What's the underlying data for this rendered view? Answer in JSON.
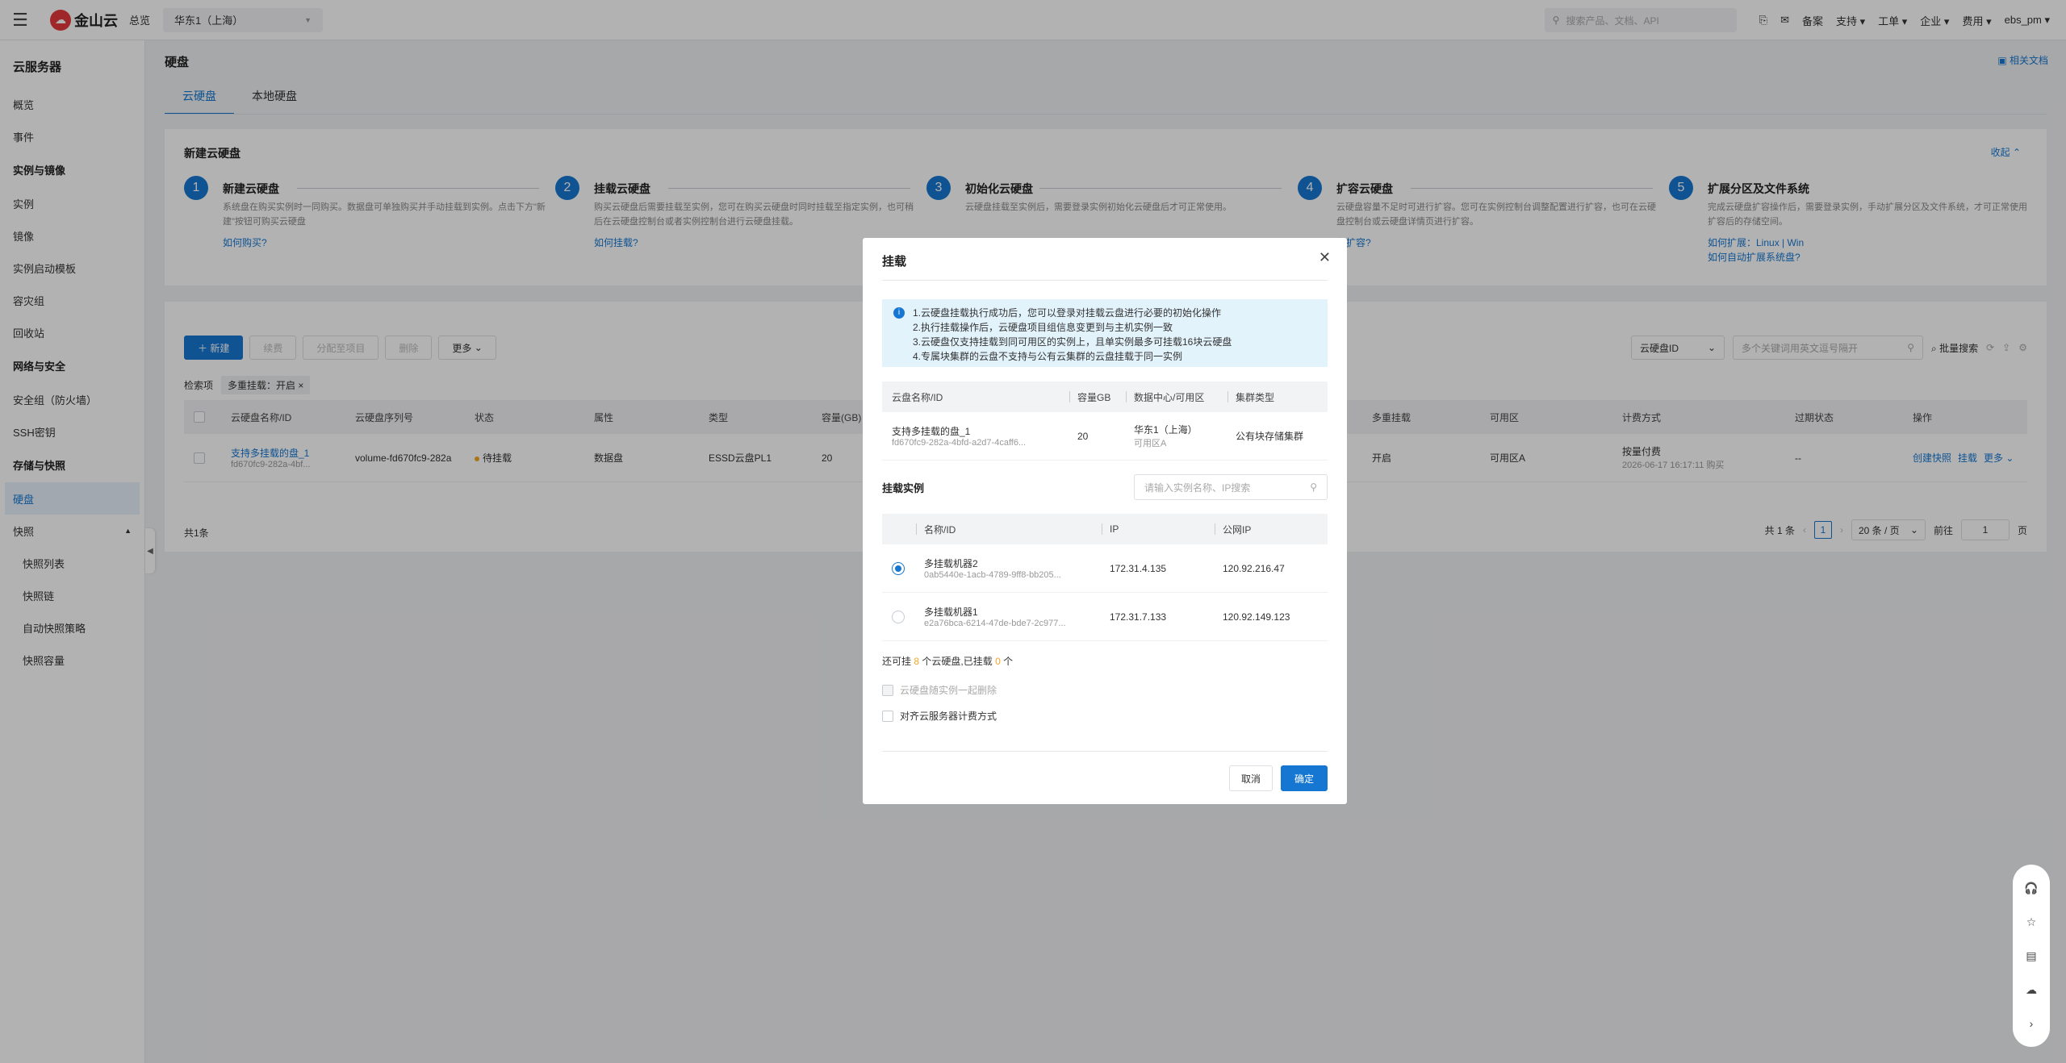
{
  "topbar": {
    "overview": "总览",
    "region": "华东1（上海）",
    "search_placeholder": "搜索产品、文档、API",
    "items": [
      "备案",
      "支持",
      "工单",
      "企业",
      "费用",
      "ebs_pm"
    ],
    "logo": "金山云"
  },
  "sidebar": {
    "title": "云服务器",
    "items": [
      {
        "type": "item",
        "label": "概览"
      },
      {
        "type": "item",
        "label": "事件"
      },
      {
        "type": "group",
        "label": "实例与镜像"
      },
      {
        "type": "item",
        "label": "实例"
      },
      {
        "type": "item",
        "label": "镜像"
      },
      {
        "type": "item",
        "label": "实例启动模板"
      },
      {
        "type": "item",
        "label": "容灾组"
      },
      {
        "type": "item",
        "label": "回收站"
      },
      {
        "type": "group",
        "label": "网络与安全"
      },
      {
        "type": "item",
        "label": "安全组（防火墙）"
      },
      {
        "type": "item",
        "label": "SSH密钥"
      },
      {
        "type": "group",
        "label": "存储与快照"
      },
      {
        "type": "item",
        "label": "硬盘",
        "active": true
      },
      {
        "type": "item",
        "label": "快照",
        "expanded": true
      },
      {
        "type": "sub",
        "label": "快照列表"
      },
      {
        "type": "sub",
        "label": "快照链"
      },
      {
        "type": "sub",
        "label": "自动快照策略"
      },
      {
        "type": "sub",
        "label": "快照容量"
      }
    ]
  },
  "page": {
    "title": "硬盘",
    "doc_link": "相关文档",
    "tabs": [
      "云硬盘",
      "本地硬盘"
    ]
  },
  "guide": {
    "title": "新建云硬盘",
    "collapse": "收起",
    "steps": [
      {
        "num": "1",
        "name": "新建云硬盘",
        "desc": "系统盘在购买实例时一同购买。数据盘可单独购买并手动挂载到实例。点击下方\"新建\"按钮可购买云硬盘",
        "link": "如何购买?"
      },
      {
        "num": "2",
        "name": "挂载云硬盘",
        "desc": "购买云硬盘后需要挂载至实例，您可在购买云硬盘时同时挂载至指定实例，也可稍后在云硬盘控制台或者实例控制台进行云硬盘挂载。",
        "link": "如何挂载?"
      },
      {
        "num": "3",
        "name": "初始化云硬盘",
        "desc": "云硬盘挂载至实例后，需要登录实例初始化云硬盘后才可正常使用。",
        "link": ""
      },
      {
        "num": "4",
        "name": "扩容云硬盘",
        "desc": "云硬盘容量不足时可进行扩容。您可在实例控制台调整配置进行扩容，也可在云硬盘控制台或云硬盘详情页进行扩容。",
        "link": "何扩容?"
      },
      {
        "num": "5",
        "name": "扩展分区及文件系统",
        "desc": "完成云硬盘扩容操作后，需要登录实例，手动扩展分区及文件系统，才可正常使用扩容后的存储空间。",
        "link": "如何扩展：Linux | Win",
        "link2": "如何自动扩展系统盘?"
      }
    ]
  },
  "toolbar": {
    "new": "新建",
    "buttons": [
      "续费",
      "分配至项目",
      "删除"
    ],
    "more": "更多"
  },
  "filter": {
    "label": "检索项",
    "chip": "多重挂载：开启"
  },
  "search2": {
    "select": "云硬盘ID",
    "placeholder": "多个关键词用英文逗号隔开",
    "batch": "批量搜索"
  },
  "table": {
    "headers": [
      "云硬盘名称/ID",
      "云硬盘序列号",
      "状态",
      "属性",
      "类型",
      "容量(GB)",
      "多重挂载",
      "可用区",
      "计费方式",
      "过期状态",
      "操作"
    ],
    "row": {
      "name": "支持多挂载的盘_1",
      "id": "fd670fc9-282a-4bf...",
      "serial": "volume-fd670fc9-282a",
      "status": "待挂载",
      "attr": "数据盘",
      "type": "ESSD云盘PL1",
      "cap": "20",
      "multi": "开启",
      "zone": "可用区A",
      "billing": "按量付费",
      "billing_time": "2026-06-17 16:17:11 购买",
      "expire": "--",
      "actions": [
        "创建快照",
        "挂载",
        "更多"
      ]
    }
  },
  "table_footer": {
    "total": "共1条",
    "pager_total": "共 1 条",
    "page": "1",
    "size": "20 条 / 页",
    "goto": "前往",
    "goto_val": "1",
    "goto_suffix": "页"
  },
  "modal": {
    "title": "挂载",
    "notice": [
      "1.云硬盘挂载执行成功后，您可以登录对挂载云盘进行必要的初始化操作",
      "2.执行挂载操作后，云硬盘项目组信息变更到与主机实例一致",
      "3.云硬盘仅支持挂载到同可用区的实例上，且单实例最多可挂载16块云硬盘",
      "4.专属块集群的云盘不支持与公有云集群的云盘挂载于同一实例"
    ],
    "disk_headers": [
      "云盘名称/ID",
      "容量GB",
      "数据中心/可用区",
      "集群类型"
    ],
    "disk": {
      "name": "支持多挂载的盘_1",
      "id": "fd670fc9-282a-4bfd-a2d7-4caff6...",
      "cap": "20",
      "dc": "华东1（上海）",
      "zone": "可用区A",
      "cluster": "公有块存储集群"
    },
    "instance_label": "挂载实例",
    "instance_search": "请输入实例名称、IP搜索",
    "inst_headers": [
      "名称/ID",
      "IP",
      "公网IP"
    ],
    "instances": [
      {
        "name": "多挂载机器2",
        "id": "0ab5440e-1acb-4789-9ff8-bb205...",
        "ip": "172.31.4.135",
        "pip": "120.92.216.47",
        "selected": true
      },
      {
        "name": "多挂载机器1",
        "id": "e2a76bca-6214-47de-bde7-2c977...",
        "ip": "172.31.7.133",
        "pip": "120.92.149.123",
        "selected": false
      }
    ],
    "quota_pre": "还可挂",
    "quota_n1": "8",
    "quota_mid": "个云硬盘,已挂载",
    "quota_n2": "0",
    "quota_suf": "个",
    "opt1": "云硬盘随实例一起删除",
    "opt2": "对齐云服务器计费方式",
    "cancel": "取消",
    "confirm": "确定"
  }
}
